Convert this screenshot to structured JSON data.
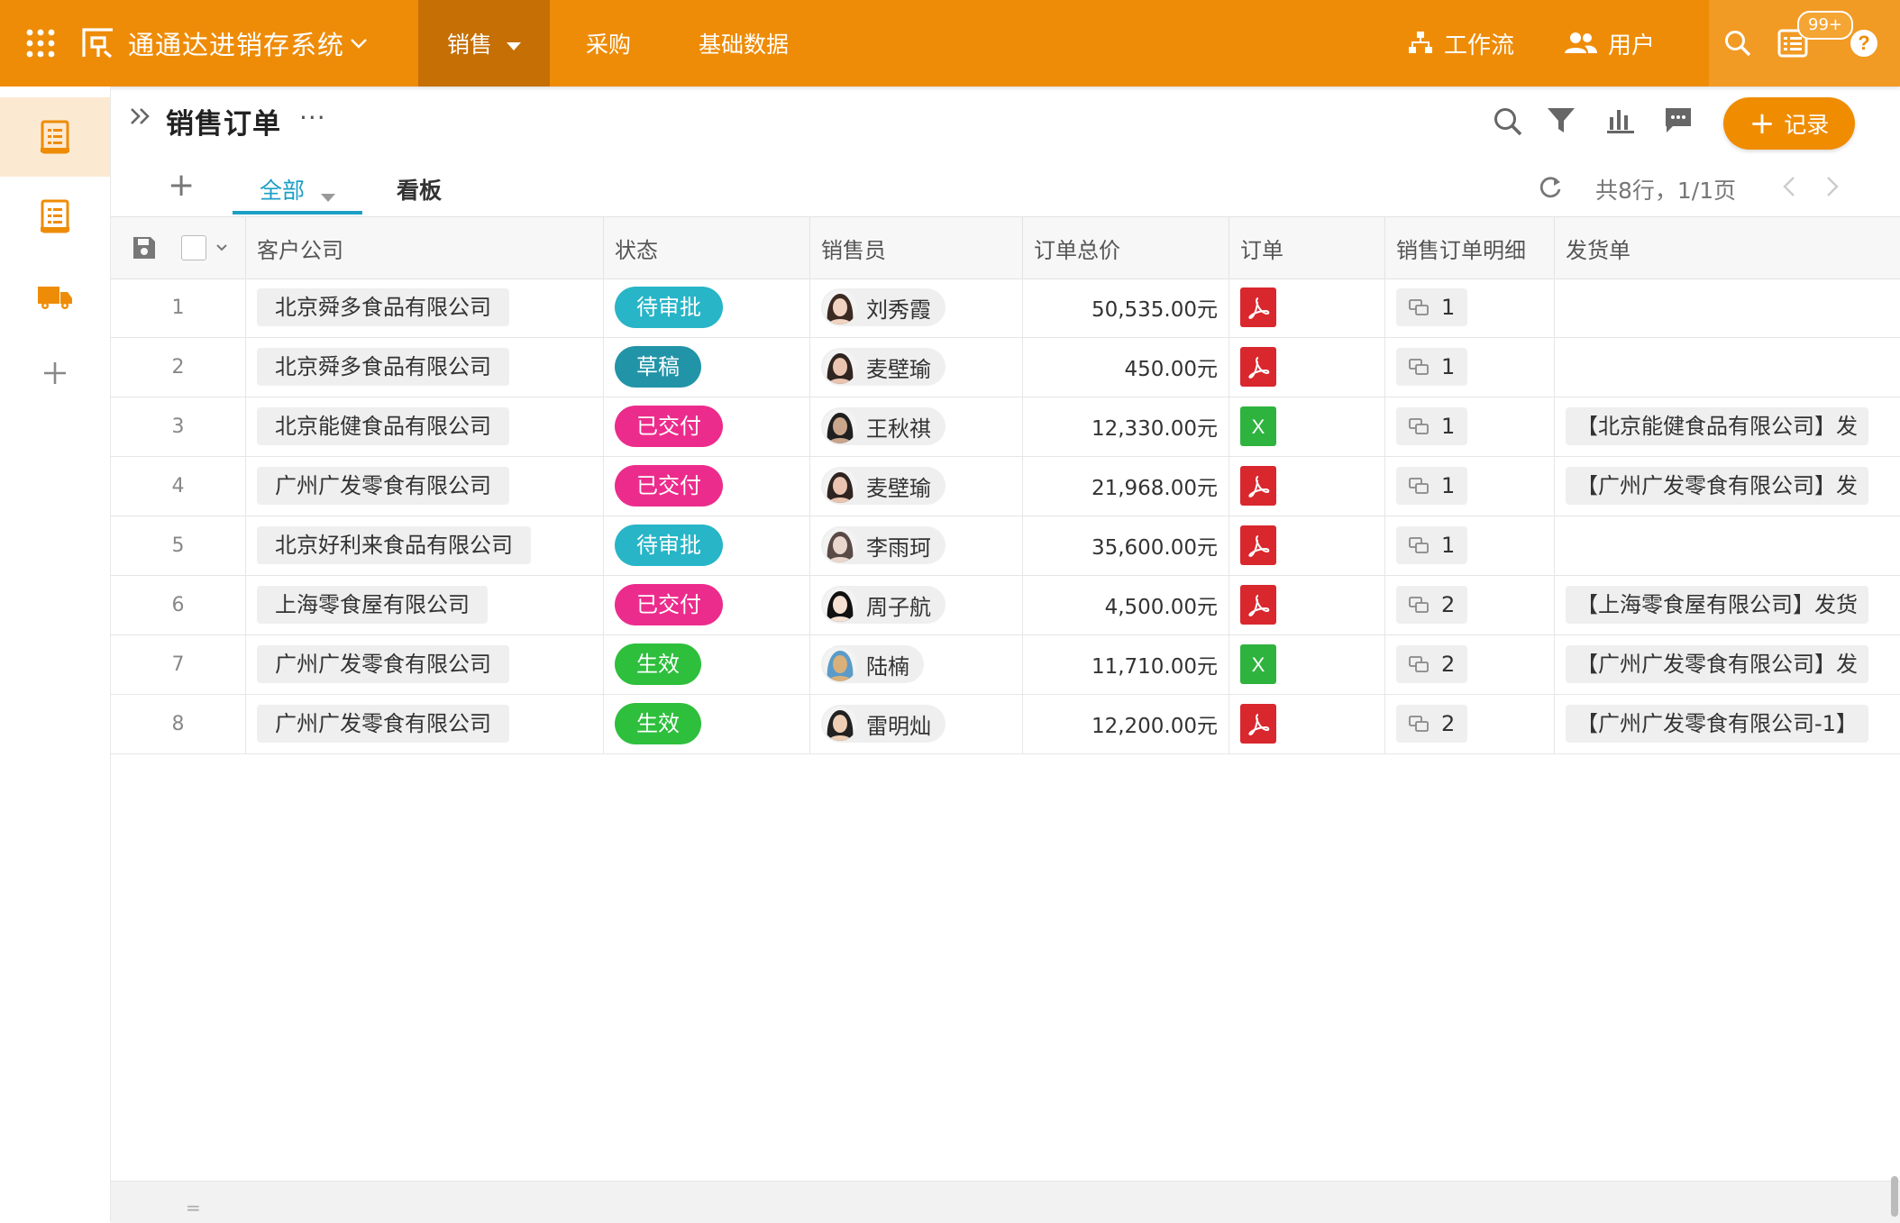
{
  "topbar": {
    "app_title": "通通达进销存系统",
    "nav": [
      {
        "label": "销售"
      },
      {
        "label": "采购"
      },
      {
        "label": "基础数据"
      }
    ],
    "workflow_label": "工作流",
    "users_label": "用户",
    "notification_badge": "99+"
  },
  "page": {
    "title": "销售订单",
    "more": "···",
    "add_record_label": "记录",
    "add_record_plus": "+",
    "tab_add": "+",
    "tabs": [
      {
        "label": "全部"
      },
      {
        "label": "看板"
      }
    ],
    "pager_text": "共8行，1/1页"
  },
  "table": {
    "columns": [
      "客户公司",
      "状态",
      "销售员",
      "订单总价",
      "订单",
      "销售订单明细",
      "发货单"
    ],
    "rows": [
      {
        "num": "1",
        "company": "北京舜多食品有限公司",
        "status": "待审批",
        "status_color": "#27b5c7",
        "salesperson": "刘秀霞",
        "total": "50,535.00元",
        "order_type": "pdf",
        "detail": "1",
        "ship": ""
      },
      {
        "num": "2",
        "company": "北京舜多食品有限公司",
        "status": "草稿",
        "status_color": "#2294a8",
        "salesperson": "麦壁瑜",
        "total": "450.00元",
        "order_type": "pdf",
        "detail": "1",
        "ship": ""
      },
      {
        "num": "3",
        "company": "北京能健食品有限公司",
        "status": "已交付",
        "status_color": "#ec2c8c",
        "salesperson": "王秋祺",
        "total": "12,330.00元",
        "order_type": "xls",
        "detail": "1",
        "ship": "【北京能健食品有限公司】发"
      },
      {
        "num": "4",
        "company": "广州广发零食有限公司",
        "status": "已交付",
        "status_color": "#ec2c8c",
        "salesperson": "麦壁瑜",
        "total": "21,968.00元",
        "order_type": "pdf",
        "detail": "1",
        "ship": "【广州广发零食有限公司】发"
      },
      {
        "num": "5",
        "company": "北京好利来食品有限公司",
        "status": "待审批",
        "status_color": "#27b5c7",
        "salesperson": "李雨珂",
        "total": "35,600.00元",
        "order_type": "pdf",
        "detail": "1",
        "ship": ""
      },
      {
        "num": "6",
        "company": "上海零食屋有限公司",
        "status": "已交付",
        "status_color": "#ec2c8c",
        "salesperson": "周子航",
        "total": "4,500.00元",
        "order_type": "pdf",
        "detail": "2",
        "ship": "【上海零食屋有限公司】发货"
      },
      {
        "num": "7",
        "company": "广州广发零食有限公司",
        "status": "生效",
        "status_color": "#2ebf3c",
        "salesperson": "陆楠",
        "total": "11,710.00元",
        "order_type": "xls",
        "detail": "2",
        "ship": "【广州广发零食有限公司】发"
      },
      {
        "num": "8",
        "company": "广州广发零食有限公司",
        "status": "生效",
        "status_color": "#2ebf3c",
        "salesperson": "雷明灿",
        "total": "12,200.00元",
        "order_type": "pdf",
        "detail": "2",
        "ship": "【广州广发零食有限公司-1】"
      }
    ]
  },
  "footer": {
    "handle": "="
  },
  "colors": {
    "brand": "#ee8c07",
    "tab_active": "#1b9fc5",
    "pdf": "#d9272e",
    "xls": "#2eb33e"
  },
  "icons": [
    "apps-grid-icon",
    "logo-icon",
    "chevron-down-icon",
    "workflow-icon",
    "users-icon",
    "search-icon",
    "notification-icon",
    "help-icon",
    "filter-icon",
    "chart-icon",
    "comment-icon",
    "refresh-icon",
    "chevron-left-icon",
    "chevron-right-icon",
    "save-icon",
    "pdf-file-icon",
    "excel-file-icon",
    "link-records-icon"
  ]
}
